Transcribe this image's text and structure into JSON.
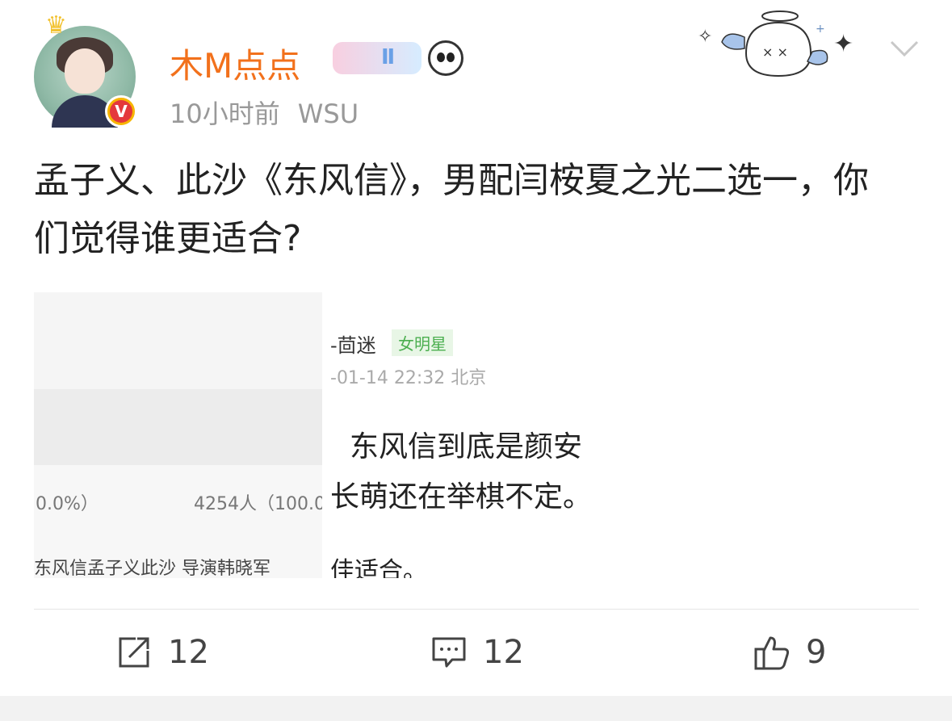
{
  "post": {
    "author": "木M点点",
    "level_badge": "Ⅱ",
    "time": "10小时前",
    "source": "WSU",
    "content": "孟子义、此沙《东风信》，男配闫桉夏之光二选一，你们觉得谁更适合?"
  },
  "image_left": {
    "pct_left": "0.0%）",
    "pct_right": "4254人（100.0",
    "caption": "东风信孟子义此沙 导演韩晓军"
  },
  "image_right": {
    "name": "-茴迷",
    "tag": "女明星",
    "time": "-01-14 22:32 北京",
    "line1": "东风信到底是颜安",
    "line2": "长萌还在举棋不定。",
    "line3": "佳适合。"
  },
  "actions": {
    "share_count": "12",
    "comment_count": "12",
    "like_count": "9"
  },
  "icons": {
    "avatar": "avatar",
    "verified": "verified-v-icon",
    "panda": "panda-emoji-icon",
    "chevron": "chevron-down-icon",
    "share": "share-icon",
    "comment": "comment-icon",
    "like": "thumbs-up-icon"
  },
  "colors": {
    "username": "#f2711c",
    "meta": "#999999",
    "verified": "#e4393c"
  }
}
